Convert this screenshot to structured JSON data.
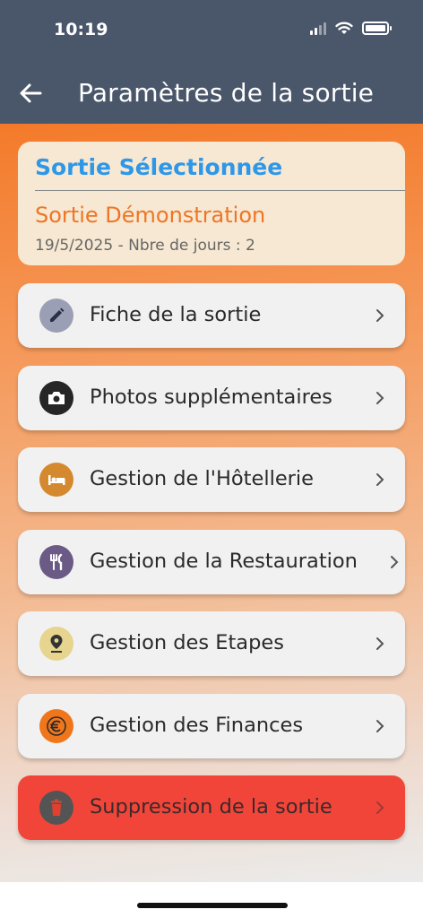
{
  "status_bar": {
    "time": "10:19"
  },
  "header": {
    "title": "Paramètres de la sortie",
    "back_icon": "arrow-left-icon"
  },
  "selected_card": {
    "heading": "Sortie Sélectionnée",
    "name": "Sortie Démonstration",
    "meta": "19/5/2025 - Nbre de jours : 2"
  },
  "menu": [
    {
      "label": "Fiche de la sortie",
      "icon": "pencil-icon",
      "icon_bg": "#9b9fb5"
    },
    {
      "label": "Photos supplémentaires",
      "icon": "camera-icon",
      "icon_bg": "#262626"
    },
    {
      "label": "Gestion de l'Hôtellerie",
      "icon": "bed-icon",
      "icon_bg": "#d4892e"
    },
    {
      "label": "Gestion de la Restauration",
      "icon": "utensils-icon",
      "icon_bg": "#6b5a86"
    },
    {
      "label": "Gestion des Etapes",
      "icon": "map-pin-icon",
      "icon_bg": "#e6d48f"
    },
    {
      "label": "Gestion des Finances",
      "icon": "euro-icon",
      "icon_bg": "#f0761c"
    },
    {
      "label": "Suppression de la sortie",
      "icon": "trash-icon",
      "icon_bg": "#545454"
    }
  ],
  "colors": {
    "header_bg": "#4a566a",
    "accent_blue": "#2f97e8",
    "accent_orange": "#f07524",
    "danger": "#f1453a"
  }
}
